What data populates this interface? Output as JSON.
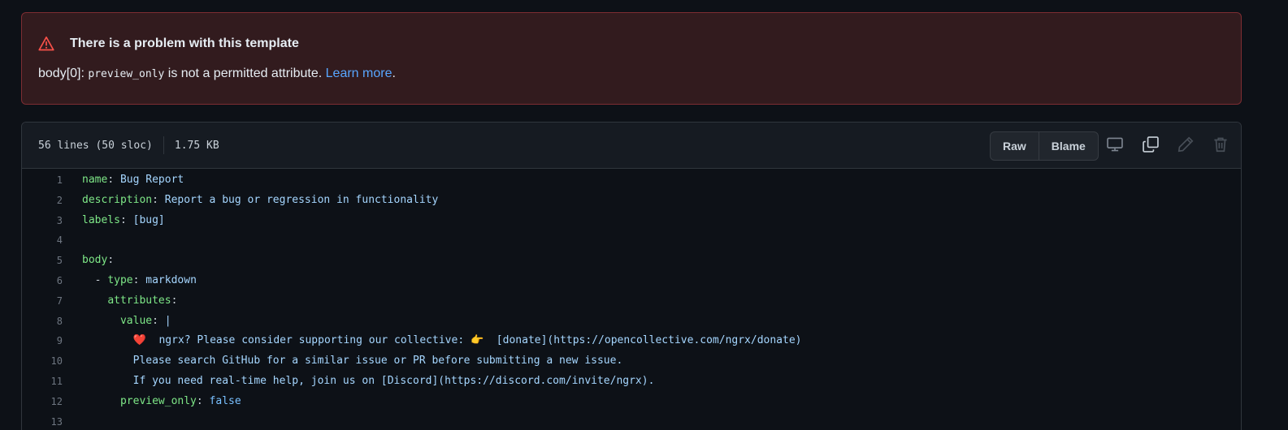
{
  "flash": {
    "title": "There is a problem with this template",
    "prefix": "body[0]:",
    "attr": "preview_only",
    "message": " is not a permitted attribute. ",
    "link": "Learn more",
    "suffix": ".",
    "icon": "alert-triangle-icon",
    "accent": "#f85149"
  },
  "file": {
    "lines_info": "56 lines (50 sloc)",
    "size": "1.75 KB",
    "raw_label": "Raw",
    "blame_label": "Blame",
    "icons": [
      "display-icon",
      "copy-icon",
      "pencil-icon",
      "trash-icon"
    ]
  },
  "code": {
    "lines": [
      {
        "n": "1",
        "key": "name",
        "sep": ": ",
        "val": "Bug Report"
      },
      {
        "n": "2",
        "key": "description",
        "sep": ": ",
        "val": "Report a bug or regression in functionality"
      },
      {
        "n": "3",
        "key": "labels",
        "sep": ": ",
        "val": "[bug]"
      },
      {
        "n": "4",
        "key": "",
        "sep": "",
        "val": ""
      },
      {
        "n": "5",
        "key": "body",
        "sep": ":",
        "val": ""
      },
      {
        "n": "6",
        "pre": "  - ",
        "key": "type",
        "sep": ": ",
        "val": "markdown"
      },
      {
        "n": "7",
        "pre": "    ",
        "key": "attributes",
        "sep": ":",
        "val": ""
      },
      {
        "n": "8",
        "pre": "      ",
        "key": "value",
        "sep": ": ",
        "val": "|"
      },
      {
        "n": "9",
        "pre": "        ",
        "key": "",
        "sep": "",
        "val": "❤️  ngrx? Please consider supporting our collective: 👉  [donate](https://opencollective.com/ngrx/donate)"
      },
      {
        "n": "10",
        "pre": "        ",
        "key": "",
        "sep": "",
        "val": "Please search GitHub for a similar issue or PR before submitting a new issue."
      },
      {
        "n": "11",
        "pre": "        ",
        "key": "",
        "sep": "",
        "val": "If you need real-time help, join us on [Discord](https://discord.com/invite/ngrx)."
      },
      {
        "n": "12",
        "pre": "      ",
        "key": "preview_only",
        "sep": ": ",
        "val": "false"
      },
      {
        "n": "13",
        "key": "",
        "sep": "",
        "val": ""
      }
    ]
  }
}
